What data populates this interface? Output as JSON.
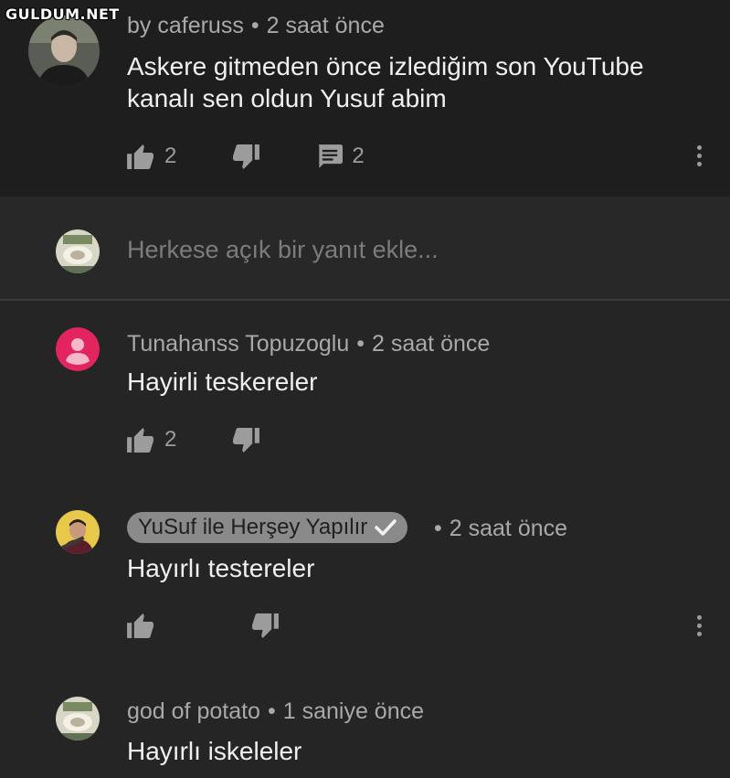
{
  "watermark": "GULDUM.NET",
  "main_comment": {
    "author": "by caferuss",
    "time": "2 saat önce",
    "text_line1": "Askere gitmeden önce izlediğim son YouTube",
    "text_line2": "kanalı sen oldun Yusuf abim",
    "likes": "2",
    "replies": "2"
  },
  "reply_box": {
    "placeholder": "Herkese açık bir yanıt ekle..."
  },
  "replies": [
    {
      "author": "Tunahanss Topuzoglu",
      "time": "2 saat önce",
      "text": "Hayirli teskereler",
      "likes": "2"
    },
    {
      "author": "YuSuf ile Herşey Yapılır",
      "time": "2 saat önce",
      "text": "Hayırlı testereler",
      "likes": ""
    },
    {
      "author": "god of potato",
      "time": "1 saniye önce",
      "text": "Hayırlı iskeleler",
      "likes": ""
    }
  ],
  "colors": {
    "background": "#252525",
    "top_background": "#1e1e1e",
    "meta_text": "#a9a9a9",
    "icon": "#9c9c9c",
    "default_avatar": "#e2245f",
    "badge": "#8a8a8a"
  },
  "icons": [
    "thumbs-up-icon",
    "thumbs-down-icon",
    "comment-icon",
    "more-vert-icon",
    "verified-check-icon"
  ]
}
